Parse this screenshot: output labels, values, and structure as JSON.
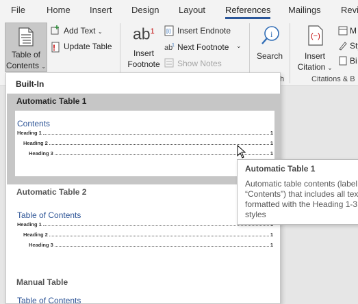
{
  "tabs": [
    {
      "label": "File",
      "active": false
    },
    {
      "label": "Home",
      "active": false
    },
    {
      "label": "Insert",
      "active": false
    },
    {
      "label": "Design",
      "active": false
    },
    {
      "label": "Layout",
      "active": false
    },
    {
      "label": "References",
      "active": true
    },
    {
      "label": "Mailings",
      "active": false
    },
    {
      "label": "Revi",
      "active": false
    }
  ],
  "ribbon": {
    "toc": {
      "line1": "Table of",
      "line2": "Contents"
    },
    "add_text": "Add Text",
    "update_table": "Update Table",
    "insert_footnote": {
      "line1": "Insert",
      "line2": "Footnote"
    },
    "insert_endnote": "Insert Endnote",
    "next_footnote": "Next Footnote",
    "show_notes": "Show Notes",
    "search": "Search",
    "insert_citation": {
      "line1": "Insert",
      "line2": "Citation"
    },
    "manage_sources_partial": "M",
    "style_partial": "Sty",
    "bibliography_partial": "Bi",
    "group_h_partial": "h",
    "group_citations": "Citations & B",
    "footnote_glyph": "ab",
    "footnote_sup": "1"
  },
  "gallery": {
    "section": "Built-In",
    "items": [
      {
        "title": "Automatic Table 1",
        "heading": "Contents",
        "lines": [
          {
            "text": "Heading 1",
            "page": "1"
          },
          {
            "text": "Heading 2",
            "page": "1"
          },
          {
            "text": "Heading 3",
            "page": "1"
          }
        ]
      },
      {
        "title": "Automatic Table 2",
        "heading": "Table of Contents",
        "lines": [
          {
            "text": "Heading 1",
            "page": "1"
          },
          {
            "text": "Heading 2",
            "page": "1"
          },
          {
            "text": "Heading 3",
            "page": "1"
          }
        ]
      },
      {
        "title": "Manual Table",
        "heading": "Table of Contents"
      }
    ]
  },
  "tooltip": {
    "title": "Automatic Table 1",
    "body": "Automatic table contents (label\n“Contents”) that includes all tex\nformatted with the Heading 1-3\nstyles"
  },
  "colors": {
    "accent": "#2b579a",
    "toc_heading": "#2e5597",
    "red_icon": "#c00000",
    "blue_icon": "#2f6cb5"
  }
}
